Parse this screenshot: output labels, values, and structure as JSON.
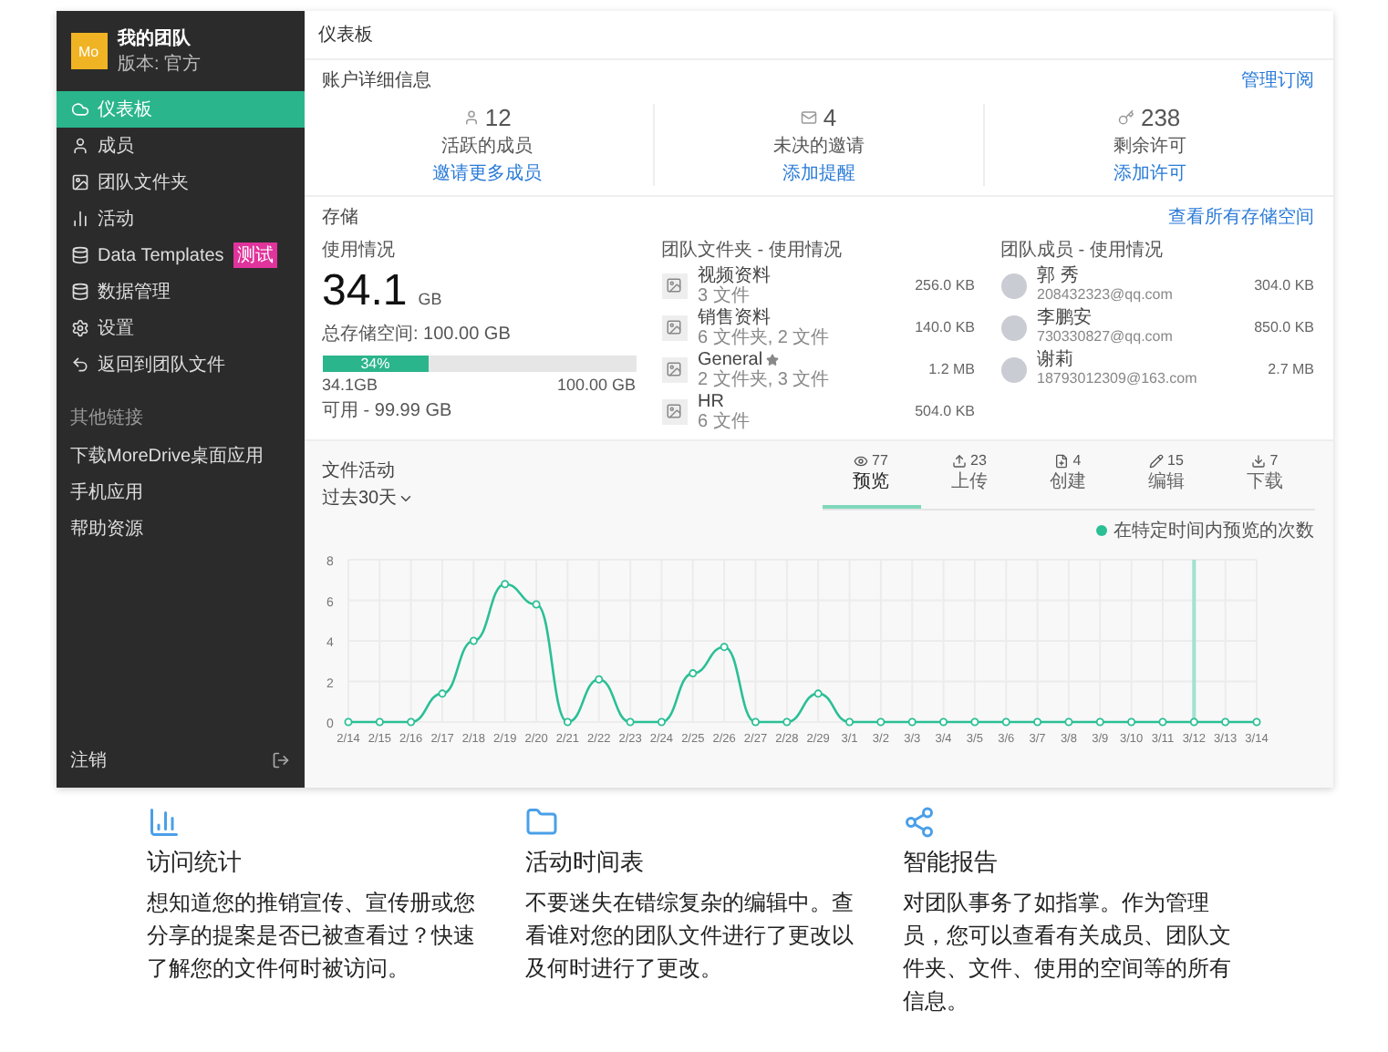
{
  "sidebar": {
    "logo": "Mo",
    "team": "我的团队",
    "edition": "版本: 官方",
    "items": [
      {
        "label": "仪表板",
        "selected": true
      },
      {
        "label": "成员",
        "selected": false
      },
      {
        "label": "团队文件夹",
        "selected": false
      },
      {
        "label": "活动",
        "selected": false
      },
      {
        "label": "Data Templates",
        "badge": "测试",
        "selected": false
      },
      {
        "label": "数据管理",
        "selected": false
      },
      {
        "label": "设置",
        "selected": false
      },
      {
        "label": "返回到团队文件",
        "selected": false
      }
    ],
    "other_title": "其他链接",
    "links": [
      "下载MoreDrive桌面应用",
      "手机应用",
      "帮助资源"
    ],
    "logout": "注销"
  },
  "header": {
    "title": "仪表板"
  },
  "account": {
    "title": "账户详细信息",
    "link": "管理订阅",
    "stats": [
      {
        "value": "12",
        "label": "活跃的成员",
        "link": "邀请更多成员"
      },
      {
        "value": "4",
        "label": "未决的邀请",
        "link": "添加提醒"
      },
      {
        "value": "238",
        "label": "剩余许可",
        "link": "添加许可"
      }
    ]
  },
  "storage": {
    "title": "存储",
    "link": "查看所有存储空间",
    "usage": {
      "title": "使用情况",
      "amount": "34.1",
      "unit": "GB",
      "total": "总存储空间: 100.00 GB",
      "bar_label": "34%",
      "level": 0.34,
      "used": "34.1GB",
      "max": "100.00 GB",
      "available": "可用 - 99.99 GB"
    },
    "folders": {
      "title": "团队文件夹 - 使用情况",
      "rows": [
        {
          "name": "视频资料",
          "starred": false,
          "detail": "3 文件",
          "size": "256.0 KB"
        },
        {
          "name": "销售资料",
          "starred": false,
          "detail": "6 文件夹, 2 文件",
          "size": "140.0 KB"
        },
        {
          "name": "General",
          "starred": true,
          "detail": "2 文件夹, 3 文件",
          "size": "1.2 MB"
        },
        {
          "name": "HR",
          "starred": false,
          "detail": "6 文件",
          "size": "504.0 KB"
        }
      ]
    },
    "members": {
      "title": "团队成员 - 使用情况",
      "rows": [
        {
          "name": "郭 秀",
          "email": "208432323@qq.com",
          "size": "304.0 KB"
        },
        {
          "name": "李鹏安",
          "email": "730330827@qq.com",
          "size": "850.0 KB"
        },
        {
          "name": "谢莉",
          "email": "18793012309@163.com",
          "size": "2.7 MB"
        }
      ]
    }
  },
  "activity": {
    "title": "文件活动",
    "range": "过去30天",
    "tabs": [
      {
        "count": "77",
        "label": "预览",
        "selected": true
      },
      {
        "count": "23",
        "label": "上传",
        "selected": false
      },
      {
        "count": "4",
        "label": "创建",
        "selected": false
      },
      {
        "count": "15",
        "label": "编辑",
        "selected": false
      },
      {
        "count": "7",
        "label": "下载",
        "selected": false
      }
    ],
    "chart_data": {
      "type": "line",
      "categories": [
        "2/14",
        "2/15",
        "2/16",
        "2/17",
        "2/18",
        "2/19",
        "2/20",
        "2/21",
        "2/22",
        "2/23",
        "2/24",
        "2/25",
        "2/26",
        "2/27",
        "2/28",
        "2/29",
        "3/1",
        "3/2",
        "3/3",
        "3/4",
        "3/5",
        "3/6",
        "3/7",
        "3/8",
        "3/9",
        "3/10",
        "3/11",
        "3/12",
        "3/13",
        "3/14"
      ],
      "series": [
        {
          "name": "在特定时间内预览的次数",
          "color": "#2bbf95",
          "marker": "o",
          "values": [
            0,
            0,
            0,
            1.4,
            4,
            6.8,
            5.8,
            0,
            2.1,
            0,
            0,
            2.4,
            3.7,
            0,
            0,
            1.4,
            0,
            0,
            0,
            0,
            0,
            0,
            0,
            0,
            0,
            0,
            0,
            0,
            0,
            0
          ]
        }
      ],
      "ylim": [
        0,
        8
      ],
      "yticks": [
        0,
        2,
        4,
        6,
        8
      ],
      "grid": true,
      "ref_lines": [
        {
          "axis": "x",
          "value": "3/12",
          "color": "#9fe3cf"
        }
      ]
    }
  },
  "features": [
    {
      "title": "访问统计",
      "text": "想知道您的推销宣传、宣传册或您分享的提案是否已被查看过？快速了解您的文件何时被访问。"
    },
    {
      "title": "活动时间表",
      "text": "不要迷失在错综复杂的编辑中。查看谁对您的团队文件进行了更改以及何时进行了更改。"
    },
    {
      "title": "智能报告",
      "text": "对团队事务了如指掌。作为管理员，您可以查看有关成员、团队文件夹、文件、使用的空间等的所有信息。"
    }
  ]
}
